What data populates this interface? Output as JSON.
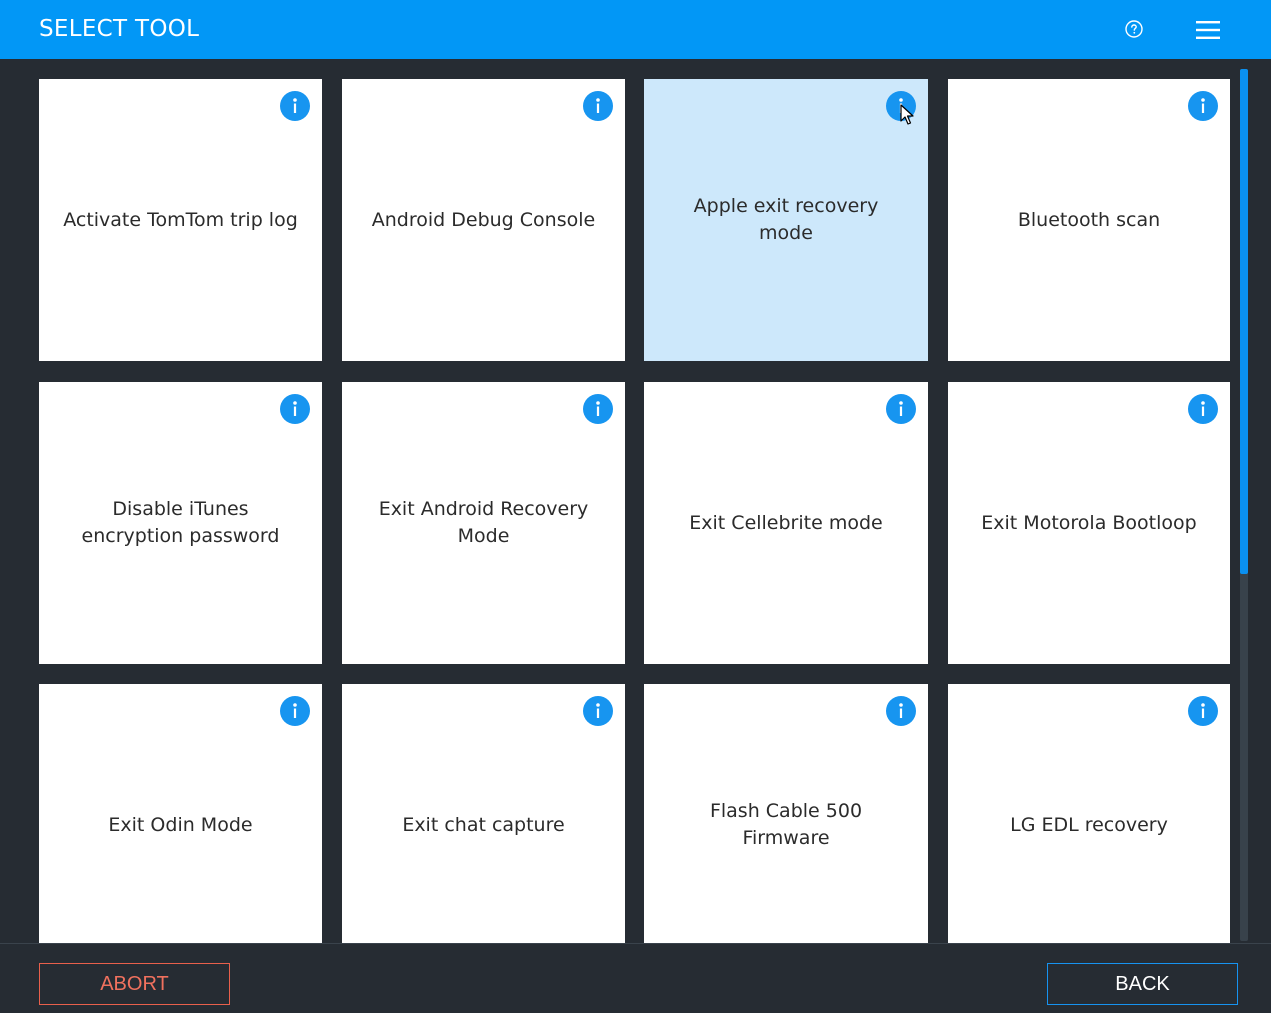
{
  "header": {
    "title": "SELECT TOOL",
    "help_icon": "help-circle-icon",
    "menu_icon": "hamburger-menu-icon"
  },
  "tools": [
    {
      "label": "Activate TomTom trip log",
      "selected": false
    },
    {
      "label": "Android Debug Console",
      "selected": false
    },
    {
      "label": "Apple exit recovery mode",
      "selected": true
    },
    {
      "label": "Bluetooth scan",
      "selected": false
    },
    {
      "label": "Disable iTunes encryption password",
      "selected": false
    },
    {
      "label": "Exit Android Recovery Mode",
      "selected": false
    },
    {
      "label": "Exit Cellebrite mode",
      "selected": false
    },
    {
      "label": "Exit Motorola Bootloop",
      "selected": false
    },
    {
      "label": "Exit Odin Mode",
      "selected": false
    },
    {
      "label": "Exit chat capture",
      "selected": false
    },
    {
      "label": "Flash Cable 500 Firmware",
      "selected": false
    },
    {
      "label": "LG EDL recovery",
      "selected": false
    }
  ],
  "footer": {
    "abort_label": "ABORT",
    "back_label": "BACK"
  },
  "colors": {
    "header_bg": "#0297f6",
    "page_bg": "#262c33",
    "tile_bg": "#ffffff",
    "tile_selected_bg": "#cde8fb",
    "info_icon": "#1795f0",
    "abort": "#f0715e",
    "back_border": "#1793f0"
  }
}
